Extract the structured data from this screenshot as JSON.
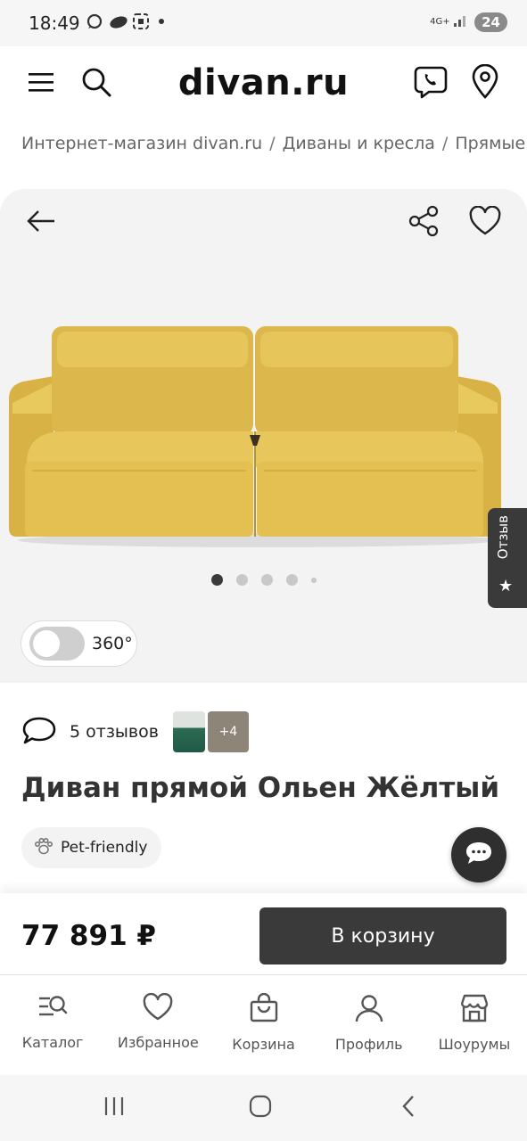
{
  "status_bar": {
    "time": "18:49",
    "network": "4G+",
    "battery": "24"
  },
  "header": {
    "logo": "divan.ru",
    "icons": [
      "menu-icon",
      "search-icon",
      "viber-phone-icon",
      "location-pin-icon"
    ]
  },
  "breadcrumb": {
    "items": [
      "Интернет-магазин divan.ru",
      "Диваны и кресла",
      "Прямые диваны"
    ],
    "separator": "/"
  },
  "gallery": {
    "slide_count": 5,
    "active_index": 0,
    "sofa_color": "#e4bf52",
    "reviews_tab_label": "Отзыв",
    "toggle_360": {
      "label": "360°",
      "enabled": false
    }
  },
  "product": {
    "reviews_label": "5 отзывов",
    "more_photos_label": "+4",
    "title": "Диван прямой Ольен Жёлтый",
    "badge": "Pet-friendly"
  },
  "buy_bar": {
    "price": "77 891 ₽",
    "add_to_cart_label": "В корзину"
  },
  "tab_bar": {
    "tabs": [
      {
        "label": "Каталог",
        "icon": "catalog-icon"
      },
      {
        "label": "Избранное",
        "icon": "heart-icon"
      },
      {
        "label": "Корзина",
        "icon": "bag-icon"
      },
      {
        "label": "Профиль",
        "icon": "profile-icon"
      },
      {
        "label": "Шоурумы",
        "icon": "store-icon"
      }
    ]
  },
  "colors": {
    "accent_dark": "#3a3a3a",
    "gallery_bg": "#f3f3f3"
  }
}
